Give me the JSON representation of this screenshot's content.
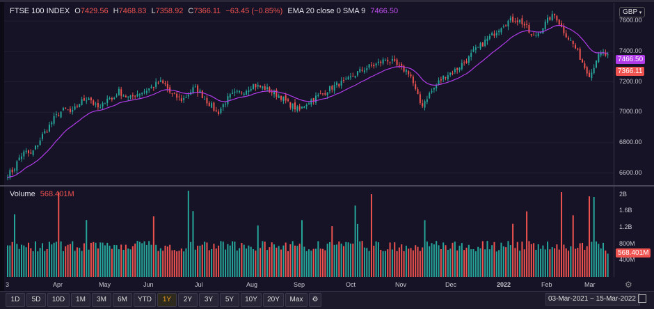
{
  "legend": {
    "symbol": "FTSE 100 INDEX",
    "open_label": "O",
    "open": "7429.56",
    "high_label": "H",
    "high": "7468.83",
    "low_label": "L",
    "low": "7358.92",
    "close_label": "C",
    "close": "7366.11",
    "change": "−63.45 (−0.85%)",
    "indicator": "EMA 20 close 0 SMA 9",
    "indicator_value": "7466.50"
  },
  "volume_legend": {
    "label": "Volume",
    "value": "568.401M"
  },
  "currency": "GBP",
  "price_tags": {
    "ema": "7466.50",
    "last": "7366.11",
    "hidden": "7400.00"
  },
  "colors": {
    "up": "#26a69a",
    "down": "#ef5350",
    "ema": "#b03be8",
    "background": "#161326"
  },
  "range_buttons": [
    "1D",
    "5D",
    "10D",
    "1M",
    "3M",
    "6M",
    "YTD",
    "1Y",
    "2Y",
    "3Y",
    "5Y",
    "10Y",
    "20Y",
    "Max"
  ],
  "active_range": "1Y",
  "date_range": "03-Mar-2021  −  15-Mar-2022",
  "chart_data": {
    "type": "candlestick",
    "price_axis": {
      "ticks": [
        "7600.00",
        "7400.00",
        "7200.00",
        "7000.00",
        "6800.00",
        "6600.00"
      ],
      "ylim": [
        6520,
        7720
      ]
    },
    "volume_axis": {
      "ticks": [
        "2B",
        "1.6B",
        "1.2B",
        "800M",
        "400M"
      ],
      "ylim": [
        0,
        2200
      ]
    },
    "x_ticks": [
      "3",
      "Apr",
      "May",
      "Jun",
      "Jul",
      "Aug",
      "Sep",
      "Oct",
      "Nov",
      "Dec",
      "2022",
      "Feb",
      "Mar"
    ],
    "close_path": [
      6590,
      6620,
      6700,
      6740,
      6720,
      6780,
      6850,
      6900,
      6960,
      7000,
      7020,
      6990,
      7050,
      7080,
      7100,
      7040,
      7020,
      7100,
      7080,
      7140,
      7110,
      7090,
      7120,
      7130,
      7150,
      7170,
      7200,
      7180,
      7120,
      7100,
      7080,
      7120,
      7160,
      7130,
      7080,
      7040,
      6990,
      7050,
      7100,
      7120,
      7130,
      7150,
      7180,
      7170,
      7160,
      7140,
      7120,
      7100,
      7060,
      7040,
      7010,
      7050,
      7080,
      7100,
      7120,
      7150,
      7170,
      7190,
      7200,
      7230,
      7260,
      7280,
      7300,
      7310,
      7330,
      7350,
      7330,
      7300,
      7280,
      7260,
      7140,
      7040,
      7100,
      7150,
      7200,
      7240,
      7260,
      7280,
      7320,
      7350,
      7400,
      7430,
      7470,
      7500,
      7540,
      7580,
      7600,
      7610,
      7600,
      7560,
      7490,
      7520,
      7570,
      7620,
      7640,
      7560,
      7500,
      7450,
      7380,
      7300,
      7240,
      7350,
      7390,
      7366
    ],
    "volume_scale_note": "volume in millions"
  }
}
